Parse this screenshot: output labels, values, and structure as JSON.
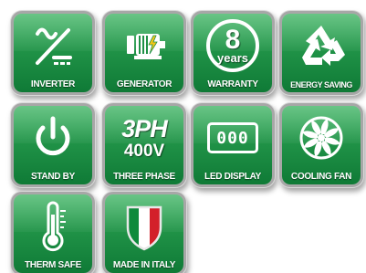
{
  "badges": [
    {
      "label": "INVERTER",
      "icon": "inverter-icon"
    },
    {
      "label": "GENERATOR",
      "icon": "generator-icon"
    },
    {
      "label": "WARRANTY",
      "icon": "warranty-icon",
      "number": "8",
      "unit": "years"
    },
    {
      "label": "ENERGY SAVING",
      "icon": "recycle-icon"
    },
    {
      "label": "STAND BY",
      "icon": "power-icon"
    },
    {
      "label": "THREE PHASE",
      "icon": "three-phase-icon",
      "line1": "3PH",
      "line2": "400V"
    },
    {
      "label": "LED DISPLAY",
      "icon": "led-display-icon",
      "digits": "000"
    },
    {
      "label": "COOLING FAN",
      "icon": "fan-icon"
    },
    {
      "label": "THERM SAFE",
      "icon": "thermometer-icon"
    },
    {
      "label": "MADE IN ITALY",
      "icon": "italy-shield-icon"
    }
  ],
  "colors": {
    "tile_green": "#1f9146",
    "frame_grey": "#a7a7a7",
    "flag_green": "#0f8a3c",
    "flag_white": "#ffffff",
    "flag_red": "#d3202a"
  }
}
